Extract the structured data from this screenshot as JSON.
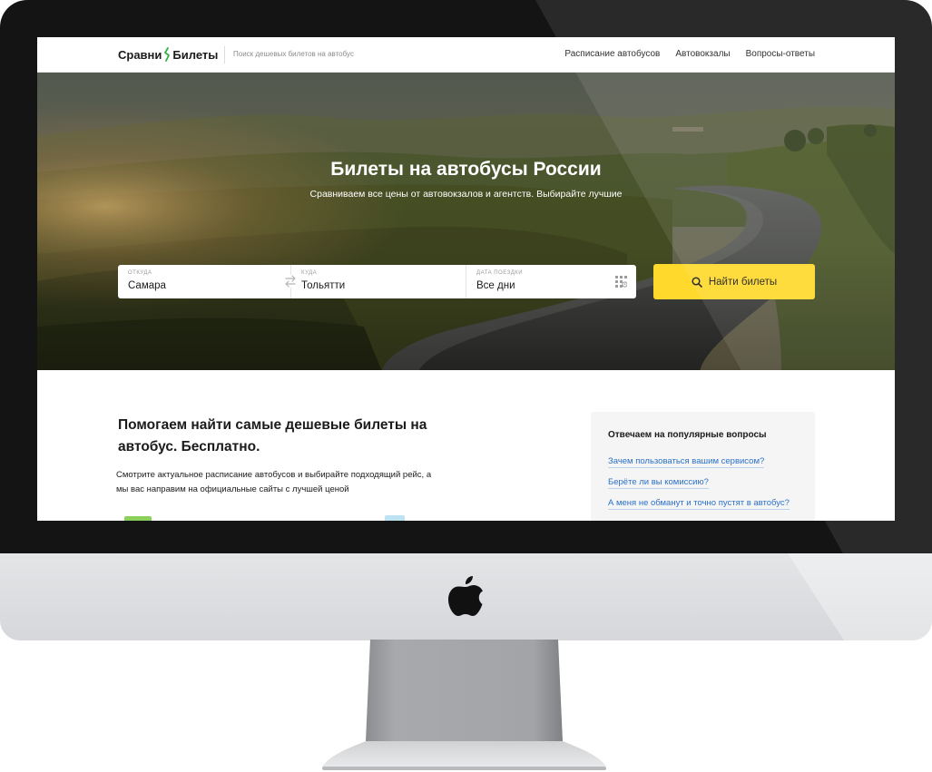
{
  "header": {
    "logo_left": "Сравни",
    "logo_right": "Билеты",
    "tagline": "Поиск дешевых билетов на автобус",
    "nav": [
      "Расписание автобусов",
      "Автовокзалы",
      "Вопросы-ответы"
    ]
  },
  "hero": {
    "title": "Билеты на автобусы России",
    "subtitle": "Сравниваем все цены от автовокзалов и агентств. Выбирайте лучшие"
  },
  "search": {
    "from_label": "ОТКУДА",
    "from_value": "Самара",
    "to_label": "КУДА",
    "to_value": "Тольятти",
    "date_label": "ДАТА ПОЕЗДКИ",
    "date_value": "Все дни",
    "button_label": "Найти билеты"
  },
  "intro": {
    "title": "Помогаем найти самые дешевые билеты на автобус. Бесплатно.",
    "text": "Смотрите актуальное расписание автобусов и выбирайте подходящий рейс, а мы вас направим на официальные сайты с лучшей ценой"
  },
  "faq": {
    "title": "Отвечаем на популярные вопросы",
    "items": [
      "Зачем пользоваться вашим сервисом?",
      "Берёте ли вы комиссию?",
      "А меня не обманут и точно пустят в автобус?"
    ]
  },
  "colors": {
    "accent_yellow": "#ffd92b",
    "link_blue": "#2a71c8",
    "logo_green": "#33b04a"
  }
}
